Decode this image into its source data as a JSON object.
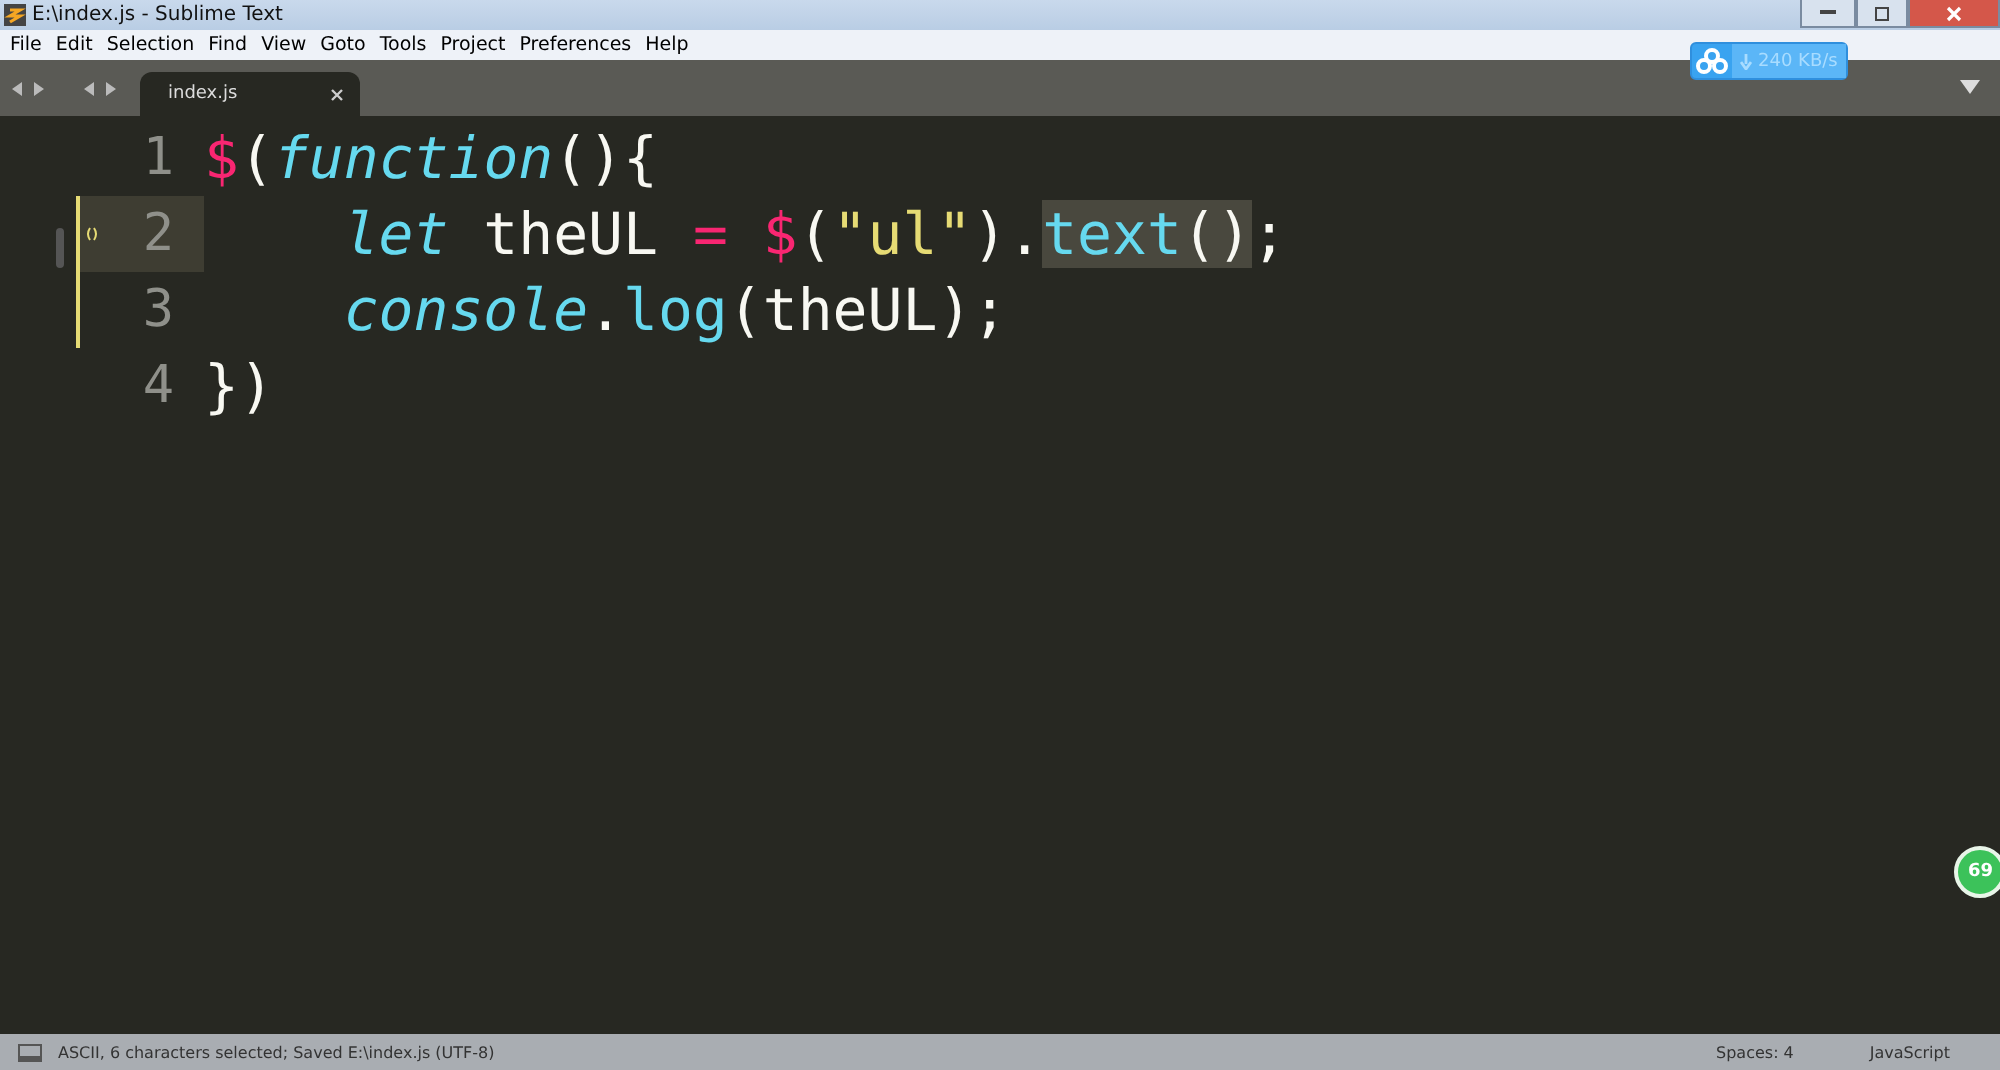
{
  "window": {
    "title": "E:\\index.js - Sublime Text"
  },
  "menu": [
    "File",
    "Edit",
    "Selection",
    "Find",
    "View",
    "Goto",
    "Tools",
    "Project",
    "Preferences",
    "Help"
  ],
  "tabs": [
    {
      "label": "index.js",
      "selected": true
    }
  ],
  "download_badge": {
    "speed": "240 KB/s"
  },
  "editor": {
    "lines": [
      {
        "number": "1",
        "indented": false,
        "current": false,
        "modified": false,
        "bracket_mark": false,
        "tokens": [
          {
            "text": "$",
            "kind": "operator",
            "selected": false
          },
          {
            "text": "(",
            "kind": "punct",
            "selected": false
          },
          {
            "text": "function",
            "kind": "keyword",
            "selected": false
          },
          {
            "text": "(){",
            "kind": "punct",
            "selected": false
          }
        ]
      },
      {
        "number": "2",
        "indented": true,
        "current": true,
        "modified": true,
        "bracket_mark": true,
        "tokens": [
          {
            "text": "let",
            "kind": "keyword",
            "selected": false
          },
          {
            "text": " theUL ",
            "kind": "punct",
            "selected": false
          },
          {
            "text": "= $",
            "kind": "operator",
            "selected": false
          },
          {
            "text": "(",
            "kind": "punct",
            "selected": false
          },
          {
            "text": "\"ul\"",
            "kind": "string",
            "selected": false
          },
          {
            "text": ").",
            "kind": "punct",
            "selected": false
          },
          {
            "text": "text",
            "kind": "function",
            "selected": true
          },
          {
            "text": "()",
            "kind": "punct",
            "selected": true
          },
          {
            "text": ";",
            "kind": "punct",
            "selected": false
          }
        ]
      },
      {
        "number": "3",
        "indented": true,
        "current": false,
        "modified": true,
        "bracket_mark": false,
        "tokens": [
          {
            "text": "console",
            "kind": "keyword",
            "selected": false
          },
          {
            "text": ".log",
            "kind": "method",
            "selected": false
          },
          {
            "text": "(theUL);",
            "kind": "punct",
            "selected": false
          }
        ]
      },
      {
        "number": "4",
        "indented": false,
        "current": false,
        "modified": false,
        "bracket_mark": false,
        "tokens": [
          {
            "text": "})",
            "kind": "punct",
            "selected": false
          }
        ]
      }
    ]
  },
  "floating_badge": {
    "text": "69"
  },
  "status_bar": {
    "message": "ASCII, 6 characters selected; Saved E:\\index.js (UTF-8)",
    "indentation": "Spaces: 4",
    "syntax": "JavaScript"
  }
}
